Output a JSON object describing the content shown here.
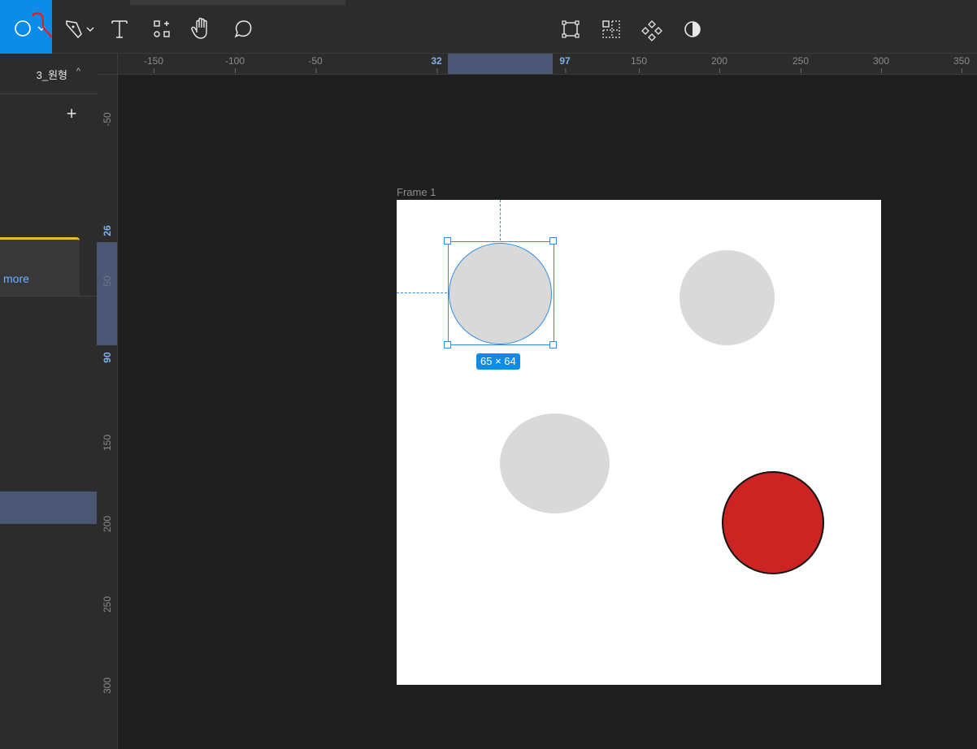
{
  "toolbar": {
    "tools": [
      {
        "name": "ellipse-tool",
        "active": true
      },
      {
        "name": "pen-tool"
      },
      {
        "name": "text-tool"
      },
      {
        "name": "resources-tool"
      },
      {
        "name": "hand-tool"
      },
      {
        "name": "comment-tool"
      }
    ],
    "center_tools": [
      "edit-object-icon",
      "slice-grid-icon",
      "component-icon",
      "contrast-icon"
    ],
    "accent": "#0c8ce9"
  },
  "left_panel": {
    "page_name": "3_원형",
    "caret": "^",
    "add_label": "+",
    "notice_link": "more"
  },
  "ruler_top": [
    "-150",
    "-100",
    "-50",
    "32",
    "97",
    "150",
    "200",
    "250",
    "300",
    "350"
  ],
  "ruler_left": [
    "-50",
    "26",
    "50",
    "90",
    "150",
    "200",
    "250",
    "300"
  ],
  "canvas": {
    "frame_label": "Frame 1",
    "selection_size": "65 × 64",
    "ellipse_fill": "#d9d9d9",
    "red_fill": "#cc2323"
  }
}
